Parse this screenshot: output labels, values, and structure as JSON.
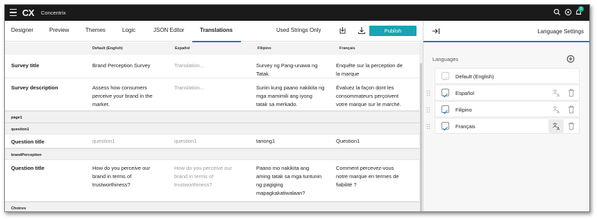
{
  "app": {
    "logo": "CX",
    "brand": "Concentrix",
    "notification_count": "0"
  },
  "toolbar": {
    "tabs": [
      {
        "label": "Designer"
      },
      {
        "label": "Preview"
      },
      {
        "label": "Themes"
      },
      {
        "label": "Logic"
      },
      {
        "label": "JSON Editor"
      },
      {
        "label": "Translations",
        "active": true
      }
    ],
    "used_strings_label": "Used Strings Only",
    "publish_label": "Publish",
    "accent_color": "#19a3b3"
  },
  "grid": {
    "columns": [
      "",
      "Default (English)",
      "Español",
      "Filipino",
      "Français"
    ],
    "rows": [
      {
        "type": "item",
        "label": "Survey title",
        "default": "Brand Perception Survey",
        "es": "Translation...",
        "fil": "Survey ng Pang-unawa ng\nTatak",
        "fr": "Enquête sur la perception de\nla marque"
      },
      {
        "type": "item",
        "label": "Survey description",
        "default": "Assess how consumers\nperceive your brand in the\nmarket.",
        "es": "Translation...",
        "fil": "Suriin kung paano nakikita ng\nmga mamimili ang iyong\ntatak sa merkado.",
        "fr": "Évaluez la façon dont les\nconsommateurs perçoivent\nvotre marque sur le marché."
      },
      {
        "type": "group",
        "label": "page1"
      },
      {
        "type": "group",
        "label": "question1"
      },
      {
        "type": "item",
        "label": "Question title",
        "default": "question1",
        "es": "question1",
        "fil": "tanong1",
        "fr": "Question1"
      },
      {
        "type": "group",
        "label": "brandPerception"
      },
      {
        "type": "item",
        "label": "Question title",
        "default": "How do you perceive our\nbrand in terms of\ntrustworthiness?",
        "es": "How do you perceive our\nbrand in terms of\ntrustworthiness?",
        "fil": "Paano mo nakikita ang\naming tatak sa mga tuntunin\nng pagiging\nmapagkakatiwalaan?",
        "fr": "Comment percevez-vous\nnotre marque en termes de\nfiabilité ?"
      },
      {
        "type": "group",
        "label": "Choices"
      }
    ]
  },
  "panel": {
    "title": "Language Settings",
    "languages_caption": "Languages",
    "languages": [
      {
        "name": "Default (English)",
        "checked": true,
        "default": true
      },
      {
        "name": "Español",
        "checked": true
      },
      {
        "name": "Filipino",
        "checked": true
      },
      {
        "name": "Français",
        "checked": true,
        "hovered": true
      }
    ],
    "accent_color": "#1976b5"
  }
}
